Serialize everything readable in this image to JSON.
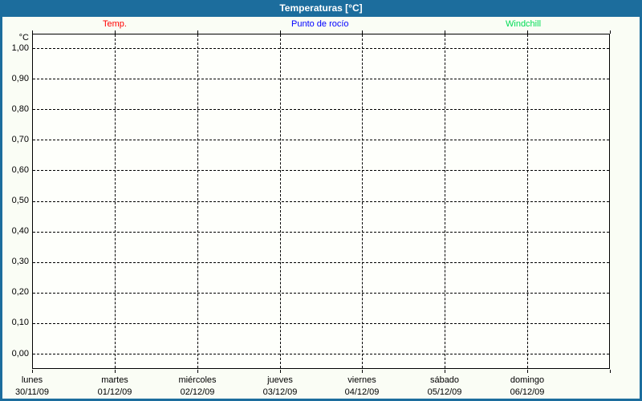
{
  "window": {
    "title": "Temperaturas [°C]"
  },
  "colors": {
    "titlebar": "#1c6d9d",
    "frame_border": "#1c6d9d",
    "page_bg": "#fafdf5",
    "plot_bg": "#fefffb",
    "grid": "#000000",
    "temp": "#ff0000",
    "dew_point": "#0000ff",
    "windchill": "#00dc55"
  },
  "legend": {
    "items": [
      {
        "label": "Temp.",
        "color_key": "temp"
      },
      {
        "label": "Punto de rocío",
        "color_key": "dew_point"
      },
      {
        "label": "Windchill",
        "color_key": "windchill"
      }
    ]
  },
  "chart_data": {
    "type": "line",
    "title": "Temperaturas [°C]",
    "ylabel": "°C",
    "ylim": [
      0.0,
      1.0
    ],
    "y_tick_labels": [
      "1,00",
      "0,90",
      "0,80",
      "0,70",
      "0,60",
      "0,50",
      "0,40",
      "0,30",
      "0,20",
      "0,10",
      "0,00"
    ],
    "x_categories": [
      {
        "day": "lunes",
        "date": "30/11/09"
      },
      {
        "day": "martes",
        "date": "01/12/09"
      },
      {
        "day": "miércoles",
        "date": "02/12/09"
      },
      {
        "day": "jueves",
        "date": "03/12/09"
      },
      {
        "day": "viernes",
        "date": "04/12/09"
      },
      {
        "day": "sábado",
        "date": "05/12/09"
      },
      {
        "day": "domingo",
        "date": "06/12/09"
      }
    ],
    "series": [
      {
        "name": "Temp.",
        "color": "#ff0000",
        "values": []
      },
      {
        "name": "Punto de rocío",
        "color": "#0000ff",
        "values": []
      },
      {
        "name": "Windchill",
        "color": "#00dc55",
        "values": []
      }
    ],
    "grid": "dashed",
    "legend_position": "top"
  }
}
